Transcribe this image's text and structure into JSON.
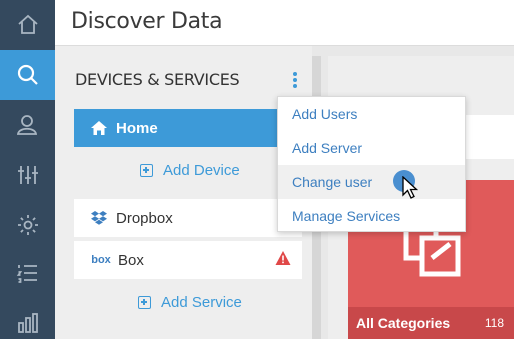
{
  "header": {
    "title": "Discover Data"
  },
  "rail": {
    "items": [
      {
        "icon": "home-icon",
        "active": false
      },
      {
        "icon": "search-icon",
        "active": true
      },
      {
        "icon": "user-icon",
        "active": false
      },
      {
        "icon": "sliders-icon",
        "active": false
      },
      {
        "icon": "gear-icon",
        "active": false
      },
      {
        "icon": "list-icon",
        "active": false
      },
      {
        "icon": "bar-chart-icon",
        "active": false
      }
    ]
  },
  "panel": {
    "title": "DEVICES & SERVICES",
    "home_label": "Home",
    "add_device_label": "Add Device",
    "services": [
      {
        "label": "Dropbox",
        "icon": "dropbox-icon"
      },
      {
        "label": "Box",
        "icon": "box-icon",
        "warning": true
      }
    ],
    "box_logo_text": "box",
    "add_service_label": "Add Service"
  },
  "menu": {
    "items": [
      {
        "label": "Add Users"
      },
      {
        "label": "Add Server"
      },
      {
        "label": "Change user",
        "hover": true
      },
      {
        "label": "Manage Services"
      }
    ]
  },
  "category_card": {
    "label": "All Categories",
    "count": "118",
    "icon": "copy-icon"
  },
  "colors": {
    "accent": "#3d9ad8",
    "rail": "#34495e",
    "category": "#e05a5a",
    "warning": "#e04848"
  }
}
